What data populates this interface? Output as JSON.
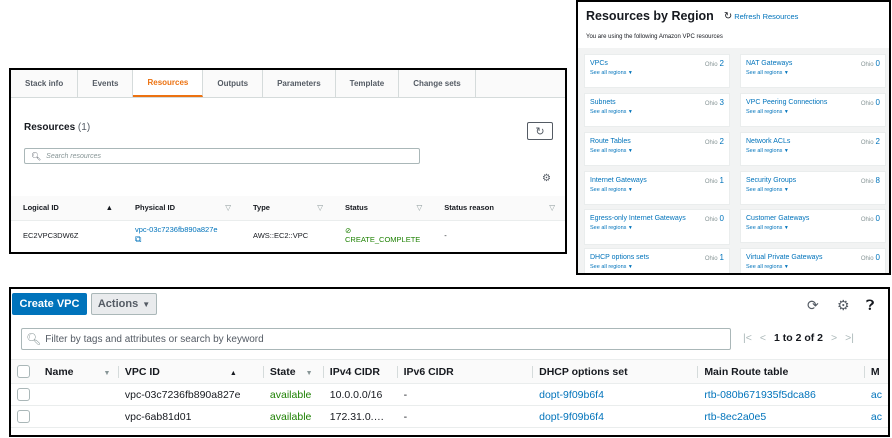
{
  "cf": {
    "tabs": [
      "Stack info",
      "Events",
      "Resources",
      "Outputs",
      "Parameters",
      "Template",
      "Change sets"
    ],
    "title": "Resources",
    "count": "(1)",
    "search_placeholder": "Search resources",
    "columns": [
      "Logical ID",
      "Physical ID",
      "Type",
      "Status",
      "Status reason"
    ],
    "row": {
      "logical_id": "EC2VPC3DW6Z",
      "physical_id": "vpc-03c7236fb890a827e",
      "type": "AWS::EC2::VPC",
      "status": "CREATE_COMPLETE",
      "reason": "-"
    }
  },
  "rbr": {
    "title": "Resources by Region",
    "refresh": "Refresh Resources",
    "subtitle": "You are using the following Amazon VPC resources",
    "see_all": "See all regions",
    "left": [
      {
        "name": "VPCs",
        "region": "Ohio",
        "count": "2"
      },
      {
        "name": "Subnets",
        "region": "Ohio",
        "count": "3"
      },
      {
        "name": "Route Tables",
        "region": "Ohio",
        "count": "2"
      },
      {
        "name": "Internet Gateways",
        "region": "Ohio",
        "count": "1"
      },
      {
        "name": "Egress-only Internet Gateways",
        "region": "Ohio",
        "count": "0"
      },
      {
        "name": "DHCP options sets",
        "region": "Ohio",
        "count": "1"
      }
    ],
    "right": [
      {
        "name": "NAT Gateways",
        "region": "Ohio",
        "count": "0"
      },
      {
        "name": "VPC Peering Connections",
        "region": "Ohio",
        "count": "0"
      },
      {
        "name": "Network ACLs",
        "region": "Ohio",
        "count": "2"
      },
      {
        "name": "Security Groups",
        "region": "Ohio",
        "count": "8"
      },
      {
        "name": "Customer Gateways",
        "region": "Ohio",
        "count": "0"
      },
      {
        "name": "Virtual Private Gateways",
        "region": "Ohio",
        "count": "0"
      }
    ]
  },
  "vpc": {
    "create_label": "Create VPC",
    "actions_label": "Actions",
    "search_placeholder": "Filter by tags and attributes or search by keyword",
    "pager": "1 to 2 of 2",
    "columns": [
      "Name",
      "VPC ID",
      "State",
      "IPv4 CIDR",
      "IPv6 CIDR",
      "DHCP options set",
      "Main Route table",
      "M"
    ],
    "rows": [
      {
        "name": "",
        "vpc_id": "vpc-03c7236fb890a827e",
        "state": "available",
        "ipv4": "10.0.0.0/16",
        "ipv6": "-",
        "dhcp": "dopt-9f09b6f4",
        "rtb": "rtb-080b671935f5dca86",
        "more": "ac"
      },
      {
        "name": "",
        "vpc_id": "vpc-6ab81d01",
        "state": "available",
        "ipv4": "172.31.0.…",
        "ipv6": "-",
        "dhcp": "dopt-9f09b6f4",
        "rtb": "rtb-8ec2a0e5",
        "more": "ac"
      }
    ]
  }
}
